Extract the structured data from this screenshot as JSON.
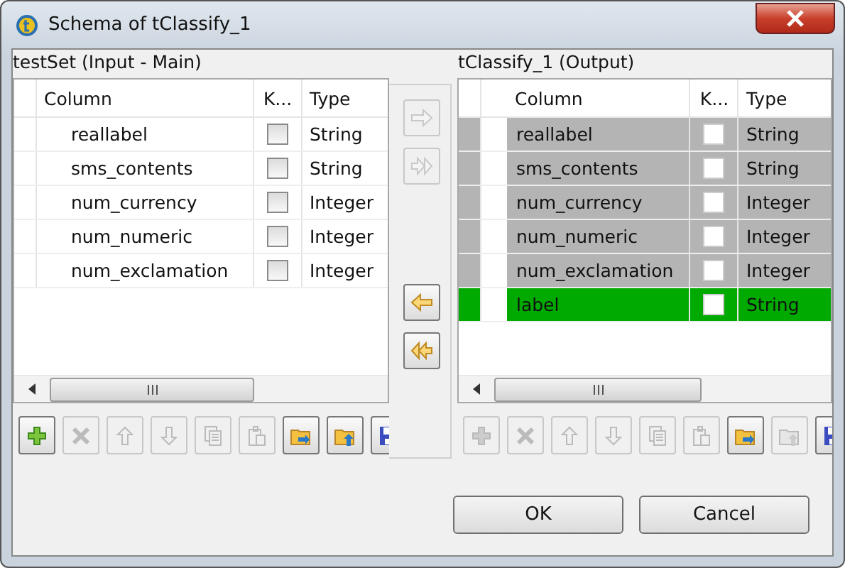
{
  "window": {
    "title": "Schema of tClassify_1"
  },
  "input_panel": {
    "title": "testSet (Input - Main)",
    "columns": [
      "Column",
      "K...",
      "Type"
    ],
    "rows": [
      {
        "column": "reallabel",
        "key": false,
        "type": "String"
      },
      {
        "column": "sms_contents",
        "key": false,
        "type": "String"
      },
      {
        "column": "num_currency",
        "key": false,
        "type": "Integer"
      },
      {
        "column": "num_numeric",
        "key": false,
        "type": "Integer"
      },
      {
        "column": "num_exclamation",
        "key": false,
        "type": "Integer"
      }
    ],
    "toolbar": [
      {
        "kind": "add",
        "disabled": false
      },
      {
        "kind": "delete",
        "disabled": true
      },
      {
        "kind": "up",
        "disabled": true
      },
      {
        "kind": "down",
        "disabled": true
      },
      {
        "kind": "copy",
        "disabled": true
      },
      {
        "kind": "paste",
        "disabled": true
      },
      {
        "kind": "import",
        "disabled": false
      },
      {
        "kind": "export",
        "disabled": false
      },
      {
        "kind": "save",
        "disabled": false
      }
    ]
  },
  "transfer_buttons": [
    {
      "kind": "right",
      "disabled": true
    },
    {
      "kind": "right-all",
      "disabled": true
    },
    {
      "kind": "left",
      "disabled": false
    },
    {
      "kind": "left-all",
      "disabled": false
    }
  ],
  "output_panel": {
    "title": "tClassify_1 (Output)",
    "columns": [
      "Column",
      "K...",
      "Type"
    ],
    "rows": [
      {
        "column": "reallabel",
        "key": false,
        "type": "String",
        "color": "#b4b4b4"
      },
      {
        "column": "sms_contents",
        "key": false,
        "type": "String",
        "color": "#b4b4b4"
      },
      {
        "column": "num_currency",
        "key": false,
        "type": "Integer",
        "color": "#b4b4b4"
      },
      {
        "column": "num_numeric",
        "key": false,
        "type": "Integer",
        "color": "#b4b4b4"
      },
      {
        "column": "num_exclamation",
        "key": false,
        "type": "Integer",
        "color": "#b4b4b4"
      },
      {
        "column": "label",
        "key": false,
        "type": "String",
        "color": "#00aa00"
      }
    ],
    "toolbar": [
      {
        "kind": "add",
        "disabled": true
      },
      {
        "kind": "delete",
        "disabled": true
      },
      {
        "kind": "up",
        "disabled": true
      },
      {
        "kind": "down",
        "disabled": true
      },
      {
        "kind": "copy",
        "disabled": true
      },
      {
        "kind": "paste",
        "disabled": true
      },
      {
        "kind": "import",
        "disabled": false
      },
      {
        "kind": "export",
        "disabled": true
      },
      {
        "kind": "save",
        "disabled": false
      }
    ]
  },
  "buttons": [
    "OK",
    "Cancel"
  ]
}
